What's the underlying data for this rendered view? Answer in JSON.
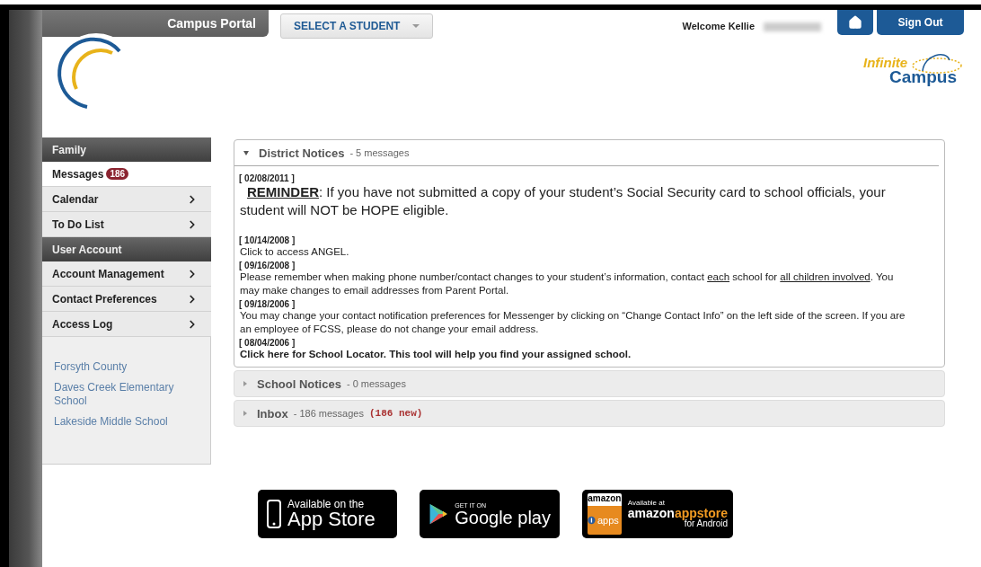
{
  "header": {
    "portal_title": "Campus Portal",
    "student_select": "SELECT A STUDENT",
    "welcome": "Welcome Kellie",
    "sign_out": "Sign Out",
    "brand_top": "Infinite",
    "brand_bottom": "Campus"
  },
  "sidebar": {
    "groups": [
      {
        "title": "Family",
        "items": [
          {
            "label": "Messages",
            "badge": "186",
            "submenu": false,
            "selected": true
          },
          {
            "label": "Calendar",
            "submenu": true,
            "selected": false
          },
          {
            "label": "To Do List",
            "submenu": true,
            "selected": false
          }
        ]
      },
      {
        "title": "User Account",
        "items": [
          {
            "label": "Account Management",
            "submenu": true,
            "selected": false
          },
          {
            "label": "Contact Preferences",
            "submenu": true,
            "selected": false
          },
          {
            "label": "Access Log",
            "submenu": true,
            "selected": false
          }
        ]
      }
    ],
    "links": [
      "Forsyth County",
      "Daves Creek Elementary School",
      "Lakeside Middle School"
    ]
  },
  "sections": [
    {
      "title": "District Notices",
      "count": "- 5 messages",
      "expanded": true,
      "notices": [
        {
          "date": "[ 02/08/2011 ]",
          "kind": "reminder",
          "segments": [
            {
              "kind": "lead",
              "text": "REMINDER"
            },
            {
              "kind": "text",
              "text": ":  If you have not submitted a copy of your student’s Social Security card to school officials, your student will NOT be HOPE eligible."
            }
          ]
        },
        {
          "date": "[ 10/14/2008 ]",
          "kind": "plain",
          "segments": [
            {
              "kind": "text",
              "text": "Click to access ANGEL."
            }
          ]
        },
        {
          "date": "[ 09/16/2008 ]",
          "kind": "plain",
          "segments": [
            {
              "kind": "text",
              "text": "Please remember when making phone number/contact changes to your student’s information, contact "
            },
            {
              "kind": "link",
              "text": "each"
            },
            {
              "kind": "text",
              "text": " school for "
            },
            {
              "kind": "link",
              "text": "all children involved"
            },
            {
              "kind": "text",
              "text": ". You may make changes to email addresses from Parent Portal."
            }
          ]
        },
        {
          "date": "[ 09/18/2006 ]",
          "kind": "plain",
          "segments": [
            {
              "kind": "text",
              "text": "You may change your contact notification preferences for Messenger by clicking on “Change Contact Info” on the left side of the screen.  If you are an employee of FCSS, please do not change your email address."
            }
          ]
        },
        {
          "date": "[ 08/04/2006 ]",
          "kind": "bold",
          "segments": [
            {
              "kind": "text",
              "text": "Click here for School Locator.   This tool will help you find your assigned school."
            }
          ]
        }
      ]
    },
    {
      "title": "School Notices",
      "count": "- 0 messages",
      "expanded": false
    },
    {
      "title": "Inbox",
      "count": "- 186 messages",
      "new": "(186 new)",
      "expanded": false
    }
  ],
  "store_badges": [
    {
      "kind": "apple",
      "small": "Available on the",
      "large": "App Store"
    },
    {
      "kind": "google",
      "small": "GET IT ON",
      "large": "Google play"
    },
    {
      "kind": "amazon",
      "tile_top": "amazon",
      "tile_bottom": "apps",
      "small": "Available at",
      "large_a": "amazon",
      "large_b": "appstore",
      "sub": "for Android"
    }
  ]
}
